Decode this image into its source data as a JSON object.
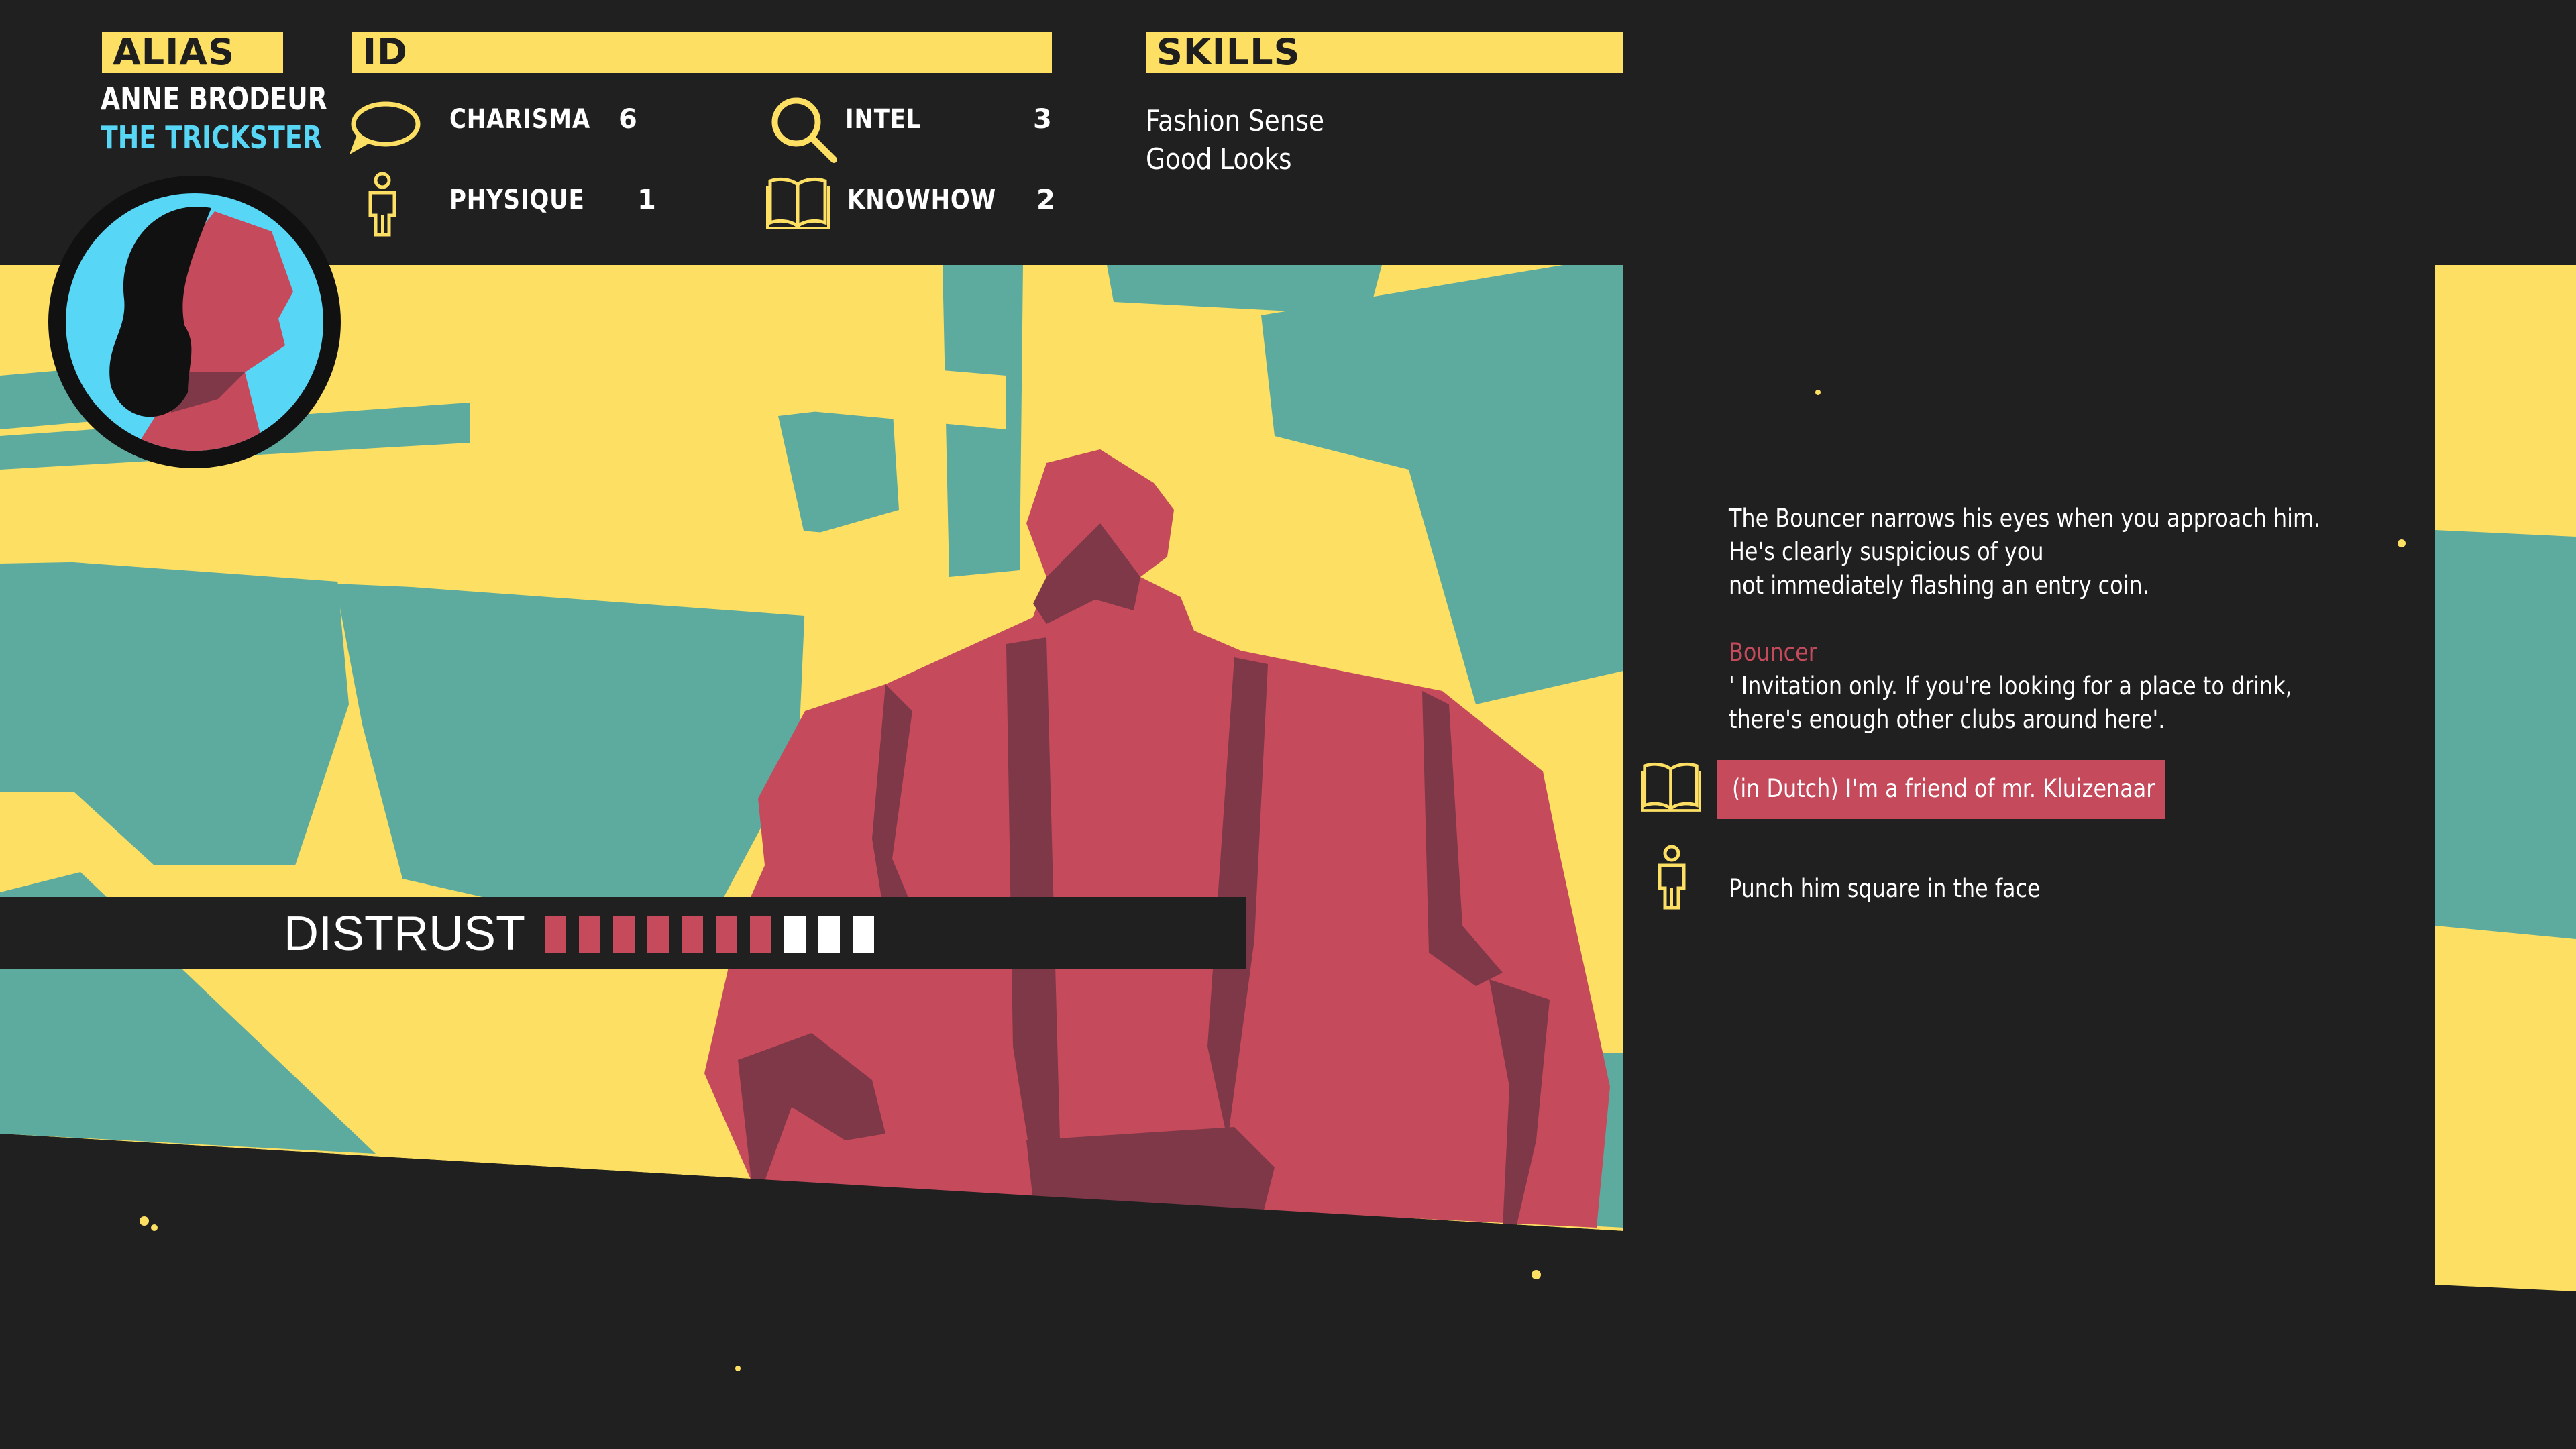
{
  "colors": {
    "background": "#202020",
    "accent_yellow": "#fde063",
    "teal": "#5dab9f",
    "bouncer_red": "#c54a5c",
    "bouncer_shadow": "#7e3848",
    "alias_cyan": "#58d6f5",
    "meter_empty": "#ffffff"
  },
  "character": {
    "alias_header": "ALIAS",
    "name": "ANNE BRODEUR",
    "title": "THE TRICKSTER"
  },
  "id_panel": {
    "header": "ID",
    "stats": [
      {
        "label": "CHARISMA",
        "value": "6",
        "icon": "speech-bubble-icon"
      },
      {
        "label": "INTEL",
        "value": "3",
        "icon": "magnifier-icon"
      },
      {
        "label": "PHYSIQUE",
        "value": "1",
        "icon": "person-icon"
      },
      {
        "label": "KNOWHOW",
        "value": "2",
        "icon": "book-icon"
      }
    ]
  },
  "skills": {
    "header": "SKILLS",
    "items": [
      "Fashion Sense",
      "Good Looks"
    ]
  },
  "meter": {
    "label": "DISTRUST",
    "filled": 7,
    "total": 10
  },
  "dialogue": {
    "narration": [
      "The Bouncer narrows his eyes when you approach him.",
      "He's clearly suspicious of you",
      "not immediately flashing an entry coin."
    ],
    "speaker": "Bouncer",
    "speech": [
      "' Invitation only. If you're looking for a place to drink,",
      "there's enough other clubs around here'."
    ],
    "choices": [
      {
        "text": "(in Dutch) I'm a friend of mr. Kluizenaar",
        "icon": "book-icon",
        "selected": true
      },
      {
        "text": "Punch him square in the face",
        "icon": "person-icon",
        "selected": false
      }
    ]
  }
}
